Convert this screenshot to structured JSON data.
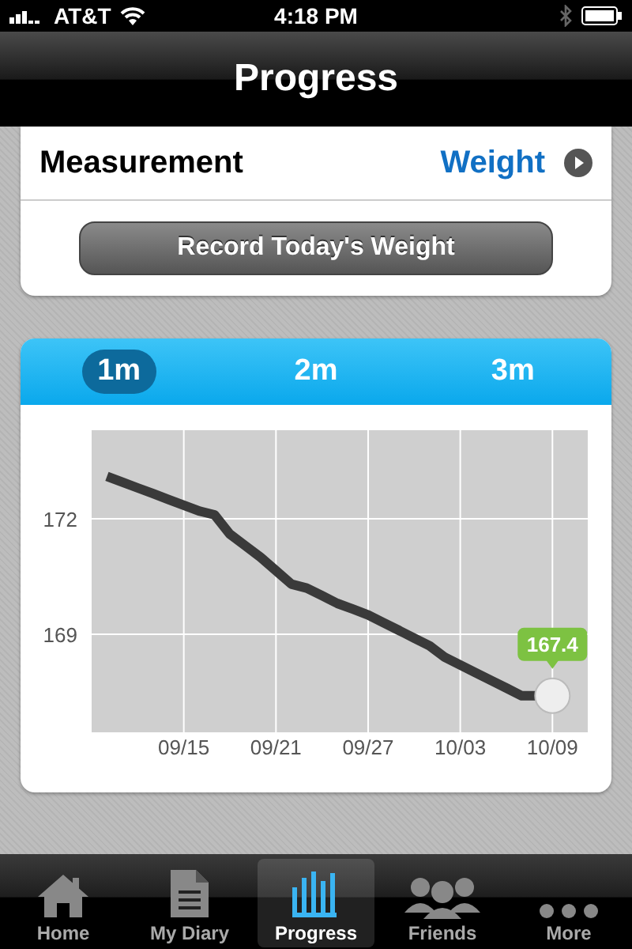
{
  "status_bar": {
    "carrier": "AT&T",
    "time": "4:18 PM"
  },
  "nav_bar": {
    "title": "Progress"
  },
  "measurement": {
    "label": "Measurement",
    "value": "Weight"
  },
  "record_button": {
    "label": "Record Today's Weight"
  },
  "range_tabs": [
    {
      "label": "1m",
      "selected": true
    },
    {
      "label": "2m",
      "selected": false
    },
    {
      "label": "3m",
      "selected": false
    }
  ],
  "chart": {
    "chart_data": {
      "type": "line",
      "categories": [
        null,
        null,
        null,
        null,
        null,
        "09/15",
        null,
        null,
        null,
        null,
        null,
        "09/21",
        null,
        null,
        null,
        null,
        null,
        "09/27",
        null,
        null,
        null,
        null,
        null,
        "10/03",
        null,
        null,
        null,
        null,
        null,
        "10/09"
      ],
      "series": [
        {
          "color": "#3a3a3a",
          "values": [
            173.1,
            172.95,
            172.8,
            172.65,
            172.5,
            172.35,
            172.2,
            172.1,
            171.6,
            171.3,
            171.0,
            170.65,
            170.3,
            170.2,
            170.0,
            169.8,
            169.65,
            169.5,
            169.3,
            169.1,
            168.9,
            168.7,
            168.4,
            168.2,
            168.0,
            167.8,
            167.6,
            167.4,
            167.4,
            167.4
          ]
        }
      ],
      "ylim": [
        166.45,
        174.3
      ],
      "yticks": [
        172,
        169
      ],
      "grid": true,
      "annotations": [
        {
          "x": "10/09",
          "y": 167.4,
          "text": "167.4"
        }
      ]
    }
  },
  "tab_bar": [
    {
      "label": "Home",
      "kind": "home",
      "selected": false
    },
    {
      "label": "My Diary",
      "kind": "diary",
      "selected": false
    },
    {
      "label": "Progress",
      "kind": "progress",
      "selected": true
    },
    {
      "label": "Friends",
      "kind": "friends",
      "selected": false
    },
    {
      "label": "More",
      "kind": "more",
      "selected": false
    }
  ]
}
